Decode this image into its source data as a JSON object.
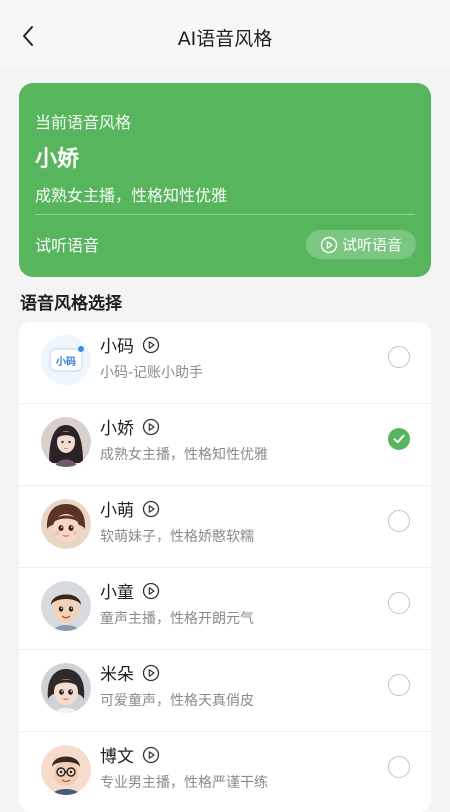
{
  "header": {
    "title": "AI语音风格"
  },
  "current": {
    "label": "当前语音风格",
    "name": "小娇",
    "desc": "成熟女主播，性格知性优雅",
    "preview_label": "试听语音",
    "preview_button": "试听语音"
  },
  "section_title": "语音风格选择",
  "items": [
    {
      "name": "小码",
      "desc": "小码-记账小助手",
      "selected": false,
      "avatar_icon": "xiaoma-logo",
      "avatar_text": "小码"
    },
    {
      "name": "小娇",
      "desc": "成熟女主播，性格知性优雅",
      "selected": true,
      "avatar_icon": "woman-portrait"
    },
    {
      "name": "小萌",
      "desc": "软萌妹子，性格娇憨软糯",
      "selected": false,
      "avatar_icon": "girl-portrait"
    },
    {
      "name": "小童",
      "desc": "童声主播，性格开朗元气",
      "selected": false,
      "avatar_icon": "boy-portrait"
    },
    {
      "name": "米朵",
      "desc": "可爱童声，性格天真俏皮",
      "selected": false,
      "avatar_icon": "child-portrait"
    },
    {
      "name": "博文",
      "desc": "专业男主播，性格严谨干练",
      "selected": false,
      "avatar_icon": "man-glasses-portrait"
    }
  ],
  "colors": {
    "accent": "#57b65d",
    "background": "#f4f4f4"
  }
}
